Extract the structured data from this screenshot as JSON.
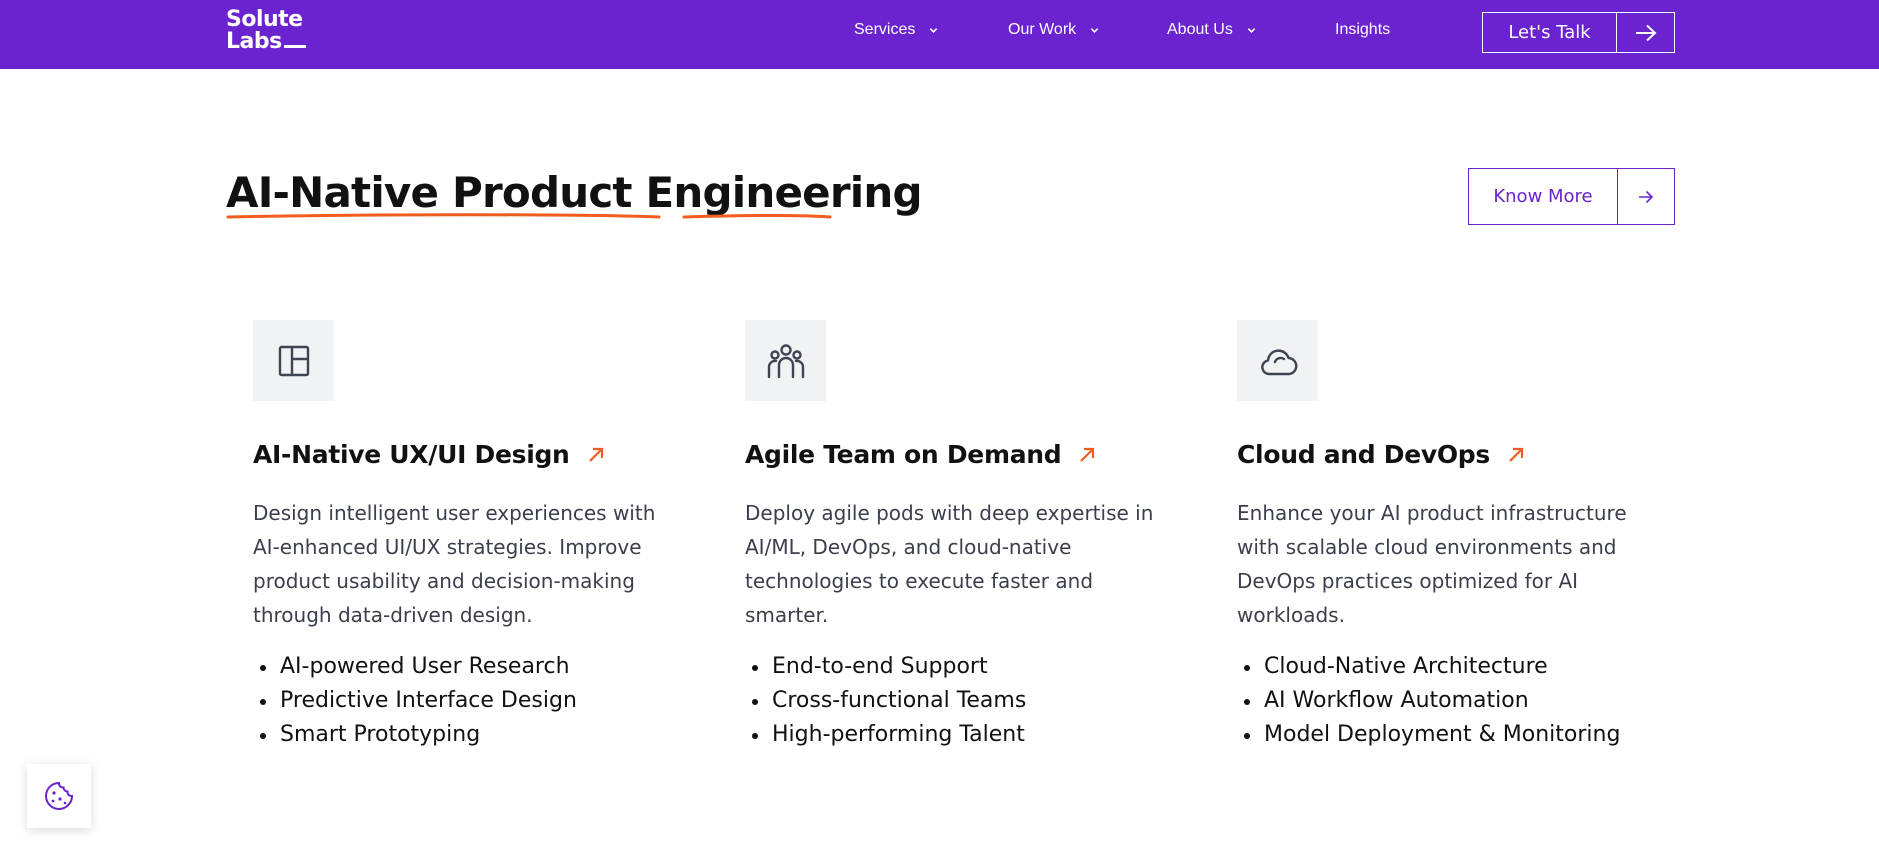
{
  "brand": {
    "line1": "Solute",
    "line2": "Labs",
    "color": "#6a23cf",
    "accent": "#f25c1c"
  },
  "nav": {
    "services": "Services",
    "our_work": "Our Work",
    "about_us": "About Us",
    "insights": "Insights",
    "cta": "Let's Talk"
  },
  "section": {
    "title": "AI-Native Product Engineering",
    "know_more": "Know More"
  },
  "cards": [
    {
      "icon": "layout-icon",
      "title": "AI-Native UX/UI Design",
      "description": "Design intelligent user experiences with AI-enhanced UI/UX strategies. Improve product usability and decision-making through data-driven design.",
      "bullets": [
        "AI-powered User Research",
        "Predictive Interface Design",
        "Smart Prototyping"
      ]
    },
    {
      "icon": "team-icon",
      "title": "Agile Team on Demand",
      "description": "Deploy agile pods with deep expertise in AI/ML, DevOps, and cloud-native technologies to execute faster and smarter.",
      "bullets": [
        "End-to-end Support",
        "Cross-functional Teams",
        "High-performing Talent"
      ]
    },
    {
      "icon": "cloud-icon",
      "title": "Cloud and DevOps",
      "description": "Enhance your AI product infrastructure with scalable cloud environments and DevOps practices optimized for AI workloads.",
      "bullets": [
        "Cloud-Native Architecture",
        "AI Workflow Automation",
        "Model Deployment & Monitoring"
      ]
    }
  ],
  "cookie": {
    "icon": "cookie-icon"
  }
}
